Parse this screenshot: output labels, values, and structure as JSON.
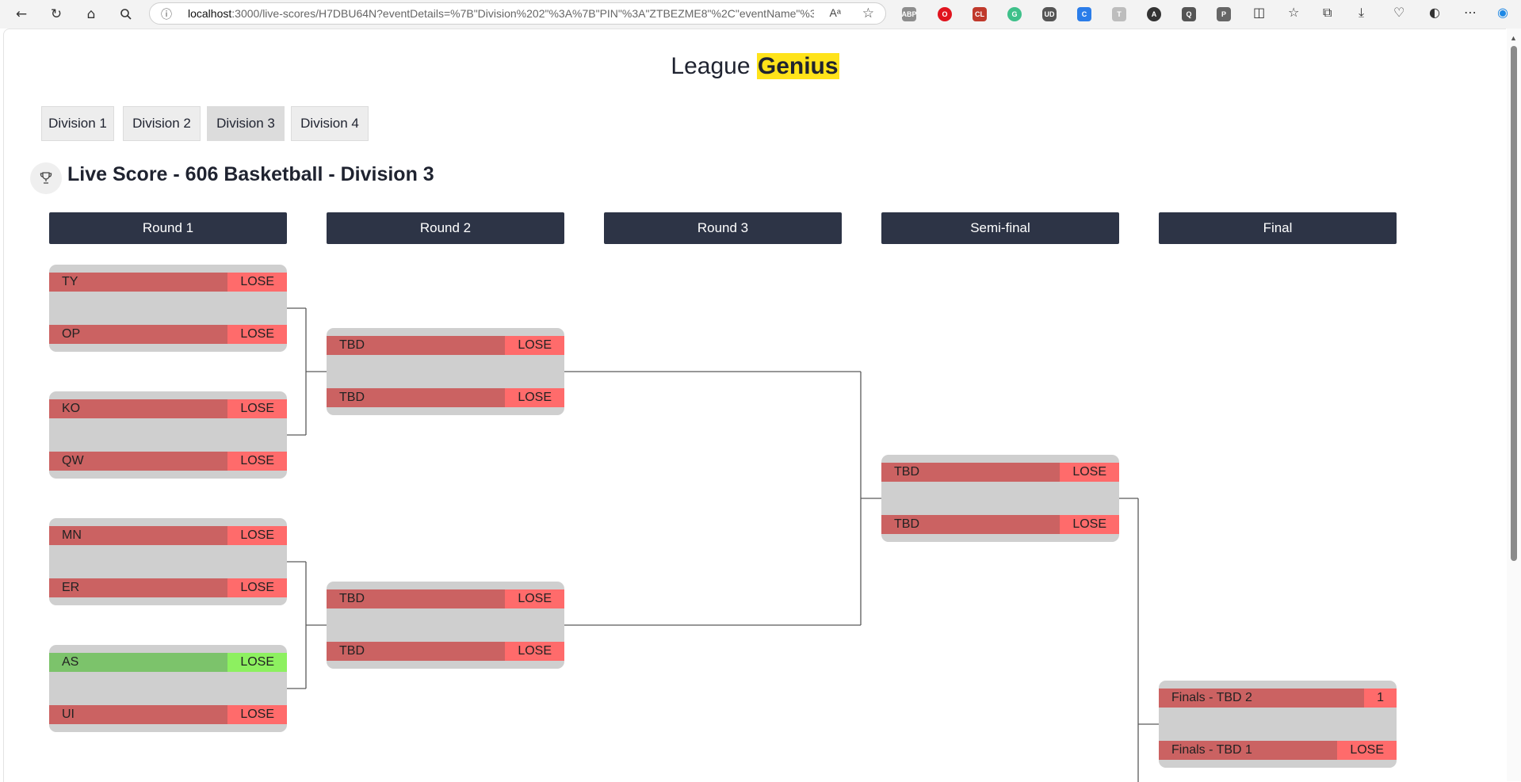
{
  "browser": {
    "url_host": "localhost",
    "url_rest": ":3000/live-scores/H7DBU64N?eventDetails=%7B\"Division%202\"%3A%7B\"PIN\"%3A\"ZTBEZME8\"%2C\"eventName\"%3A\"...",
    "read_aloud": "Aᵃ",
    "extensions": [
      "ABP",
      "O",
      "CL",
      "G",
      "UD",
      "C",
      "T",
      "A",
      "Q",
      "P"
    ]
  },
  "brand": {
    "prefix": "League ",
    "highlight": "Genius"
  },
  "divisions": [
    {
      "label": "Division 1",
      "active": false
    },
    {
      "label": "Division 2",
      "active": false
    },
    {
      "label": "Division 3",
      "active": true
    },
    {
      "label": "Division 4",
      "active": false
    }
  ],
  "title": "Live Score - 606 Basketball - Division 3",
  "rounds": [
    "Round 1",
    "Round 2",
    "Round 3",
    "Semi-final",
    "Final"
  ],
  "matches": [
    {
      "round": 1,
      "team1": {
        "name": "TY",
        "result": "LOSE"
      },
      "team2": {
        "name": "OP",
        "result": "LOSE"
      }
    },
    {
      "round": 1,
      "team1": {
        "name": "KO",
        "result": "LOSE"
      },
      "team2": {
        "name": "QW",
        "result": "LOSE"
      }
    },
    {
      "round": 1,
      "team1": {
        "name": "MN",
        "result": "LOSE"
      },
      "team2": {
        "name": "ER",
        "result": "LOSE"
      }
    },
    {
      "round": 1,
      "team1": {
        "name": "AS",
        "result": "LOSE",
        "winner": true
      },
      "team2": {
        "name": "UI",
        "result": "LOSE"
      }
    },
    {
      "round": 2,
      "team1": {
        "name": "TBD",
        "result": "LOSE"
      },
      "team2": {
        "name": "TBD",
        "result": "LOSE"
      }
    },
    {
      "round": 2,
      "team1": {
        "name": "TBD",
        "result": "LOSE"
      },
      "team2": {
        "name": "TBD",
        "result": "LOSE"
      }
    },
    {
      "round": "semi",
      "team1": {
        "name": "TBD",
        "result": "LOSE"
      },
      "team2": {
        "name": "TBD",
        "result": "LOSE"
      }
    },
    {
      "round": "final",
      "team1": {
        "name": "Finals - TBD 2",
        "result": "1"
      },
      "team2": {
        "name": "Finals - TBD 1",
        "result": "LOSE"
      }
    }
  ]
}
